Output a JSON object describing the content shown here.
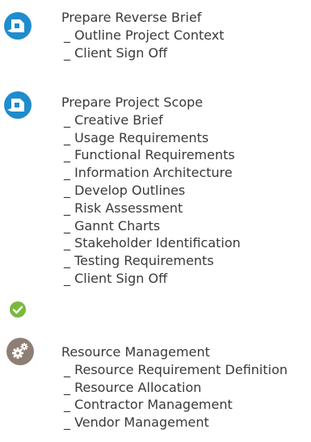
{
  "sections": [
    {
      "icon": "document-icon",
      "color": "#1f8ccd",
      "title": "Prepare Reverse Brief",
      "items": [
        "_ Outline Project Context",
        "_ Client Sign Off"
      ]
    },
    {
      "icon": "document-icon",
      "color": "#1f8ccd",
      "title": "Prepare Project Scope",
      "items": [
        "_ Creative Brief",
        "_ Usage Requirements",
        "_ Functional Requirements",
        "_ Information Architecture",
        "_ Develop Outlines",
        "_ Risk Assessment",
        "_ Gannt Charts",
        "_ Stakeholder Identification",
        "_ Testing Requirements",
        "_ Client Sign Off"
      ],
      "completed_item": "_ Client Sign Off",
      "completed_icon": "check-circle-icon",
      "completed_color": "#7ab93f"
    },
    {
      "icon": "gears-icon",
      "color": "#8f7e74",
      "title": "Resource Management",
      "items": [
        "_ Resource Requirement Definition",
        "_ Resource Allocation",
        "_ Contractor Management",
        "_ Vendor Management"
      ]
    }
  ]
}
